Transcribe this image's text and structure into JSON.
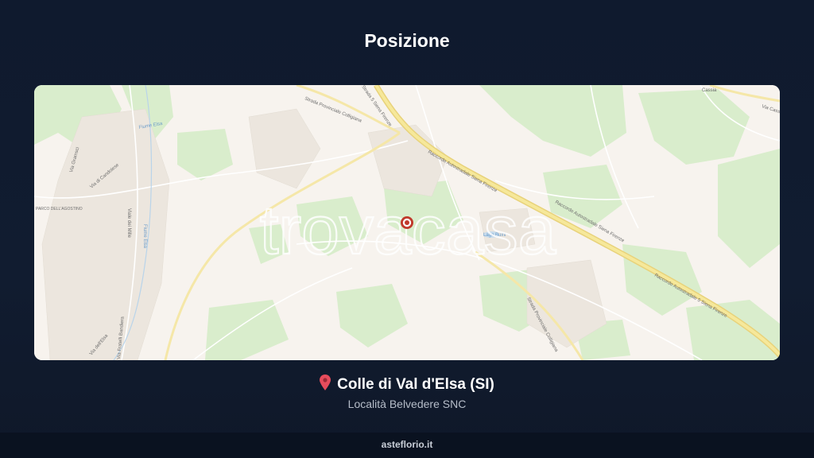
{
  "title": "Posizione",
  "map": {
    "watermark": "trovacasa",
    "labels": {
      "sp_colligiana_top": "Strada Provinciale Colligiana",
      "sp_colligiana_bottom": "Strada Provinciale Colligiana",
      "raccordo_1": "Raccordo Autostradale Siena Firenze",
      "raccordo_2": "Raccordo Autostradale Siena Firenze",
      "raccordo_3": "Raccordo Autostradale 5 Siena Firenze",
      "raccordo_top": "Strada 5 Siena Firenze",
      "via_cassia": "Via Cassia",
      "via_cassia_short": "Cassia",
      "parco": "PARCO DELL'AGOSTINO",
      "via_candolese": "Via di Candolese",
      "viale_mille": "Viale dei Mille",
      "via_fratelli": "Via Fratelli Bandiera",
      "fiume_elsa": "Fiume Elsa",
      "fiume_elsa_2": "Fiume Elsa",
      "lago": "Lago Buini",
      "via_gramsci": "Via Gramsci",
      "via_elsa": "Via dell'Elsa"
    },
    "marker": "location-marker"
  },
  "location": {
    "city": "Colle di Val d'Elsa (SI)",
    "address": "Località Belvedere SNC"
  },
  "footer": "asteflorio.it",
  "colors": {
    "background": "#0f1a2e",
    "marker": "#c0392b",
    "pin": "#e74c5c",
    "motorway": "#f2e08a",
    "green": "#d7eccb"
  }
}
